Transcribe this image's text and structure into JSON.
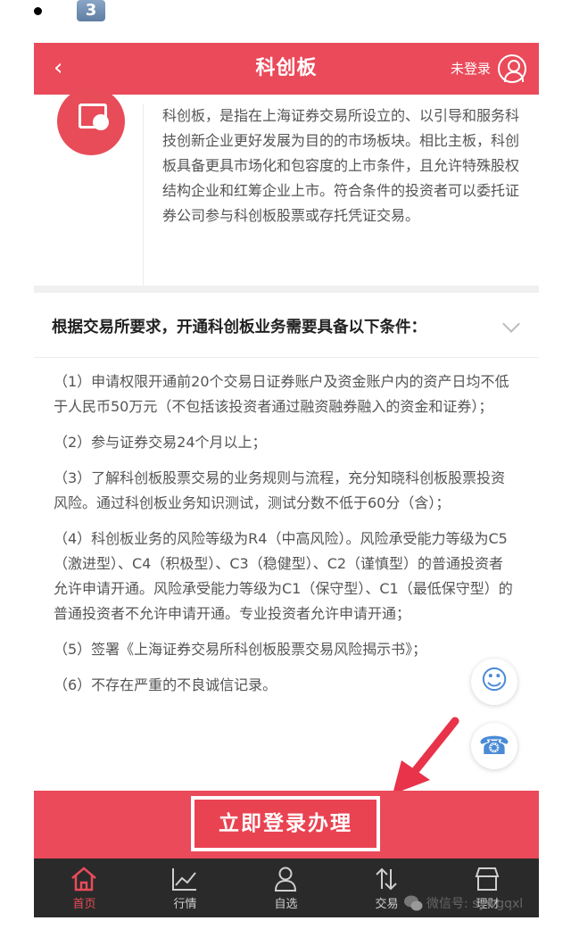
{
  "top_badge": "3",
  "header": {
    "title": "科创板",
    "login_text": "未登录"
  },
  "intro": {
    "text": "科创板，是指在上海证券交易所设立的、以引导和服务科技创新企业更好发展为目的的市场板块。相比主板，科创板具备更具市场化和包容度的上市条件，且允许特殊股权结构企业和红筹企业上市。符合条件的投资者可以委托证券公司参与科创板股票或存托凭证交易。"
  },
  "conditions": {
    "heading": "根据交易所要求，开通科创板业务需要具备以下条件：",
    "items": [
      "（1）申请权限开通前20个交易日证券账户及资金账户内的资产日均不低于人民币50万元（不包括该投资者通过融资融券融入的资金和证券）；",
      "（2）参与证券交易24个月以上；",
      "（3）了解科创板股票交易的业务规则与流程，充分知晓科创板股票投资风险。通过科创板业务知识测试，测试分数不低于60分（含）；",
      "（4）科创板业务的风险等级为R4（中高风险）。风险承受能力等级为C5（激进型）、C4（积极型）、C3（稳健型）、C2（谨慎型）的普通投资者允许申请开通。风险承受能力等级为C1（保守型）、C1（最低保守型）的普通投资者不允许申请开通。专业投资者允许申请开通；",
      "（5）签署《上海证券交易所科创板股票交易风险揭示书》；",
      "（6）不存在严重的不良诚信记录。"
    ]
  },
  "action": {
    "label": "立即登录办理"
  },
  "tabs": [
    {
      "label": "首页",
      "icon": "home-icon"
    },
    {
      "label": "行情",
      "icon": "chart-icon"
    },
    {
      "label": "自选",
      "icon": "user-icon"
    },
    {
      "label": "交易",
      "icon": "transfer-icon"
    },
    {
      "label": "理财",
      "icon": "store-icon"
    }
  ],
  "watermark": "微信号: sywgqxl",
  "colors": {
    "accent": "#ea4a5a",
    "tabbar": "#2a2a2a",
    "float_icon": "#4b8bd6"
  }
}
